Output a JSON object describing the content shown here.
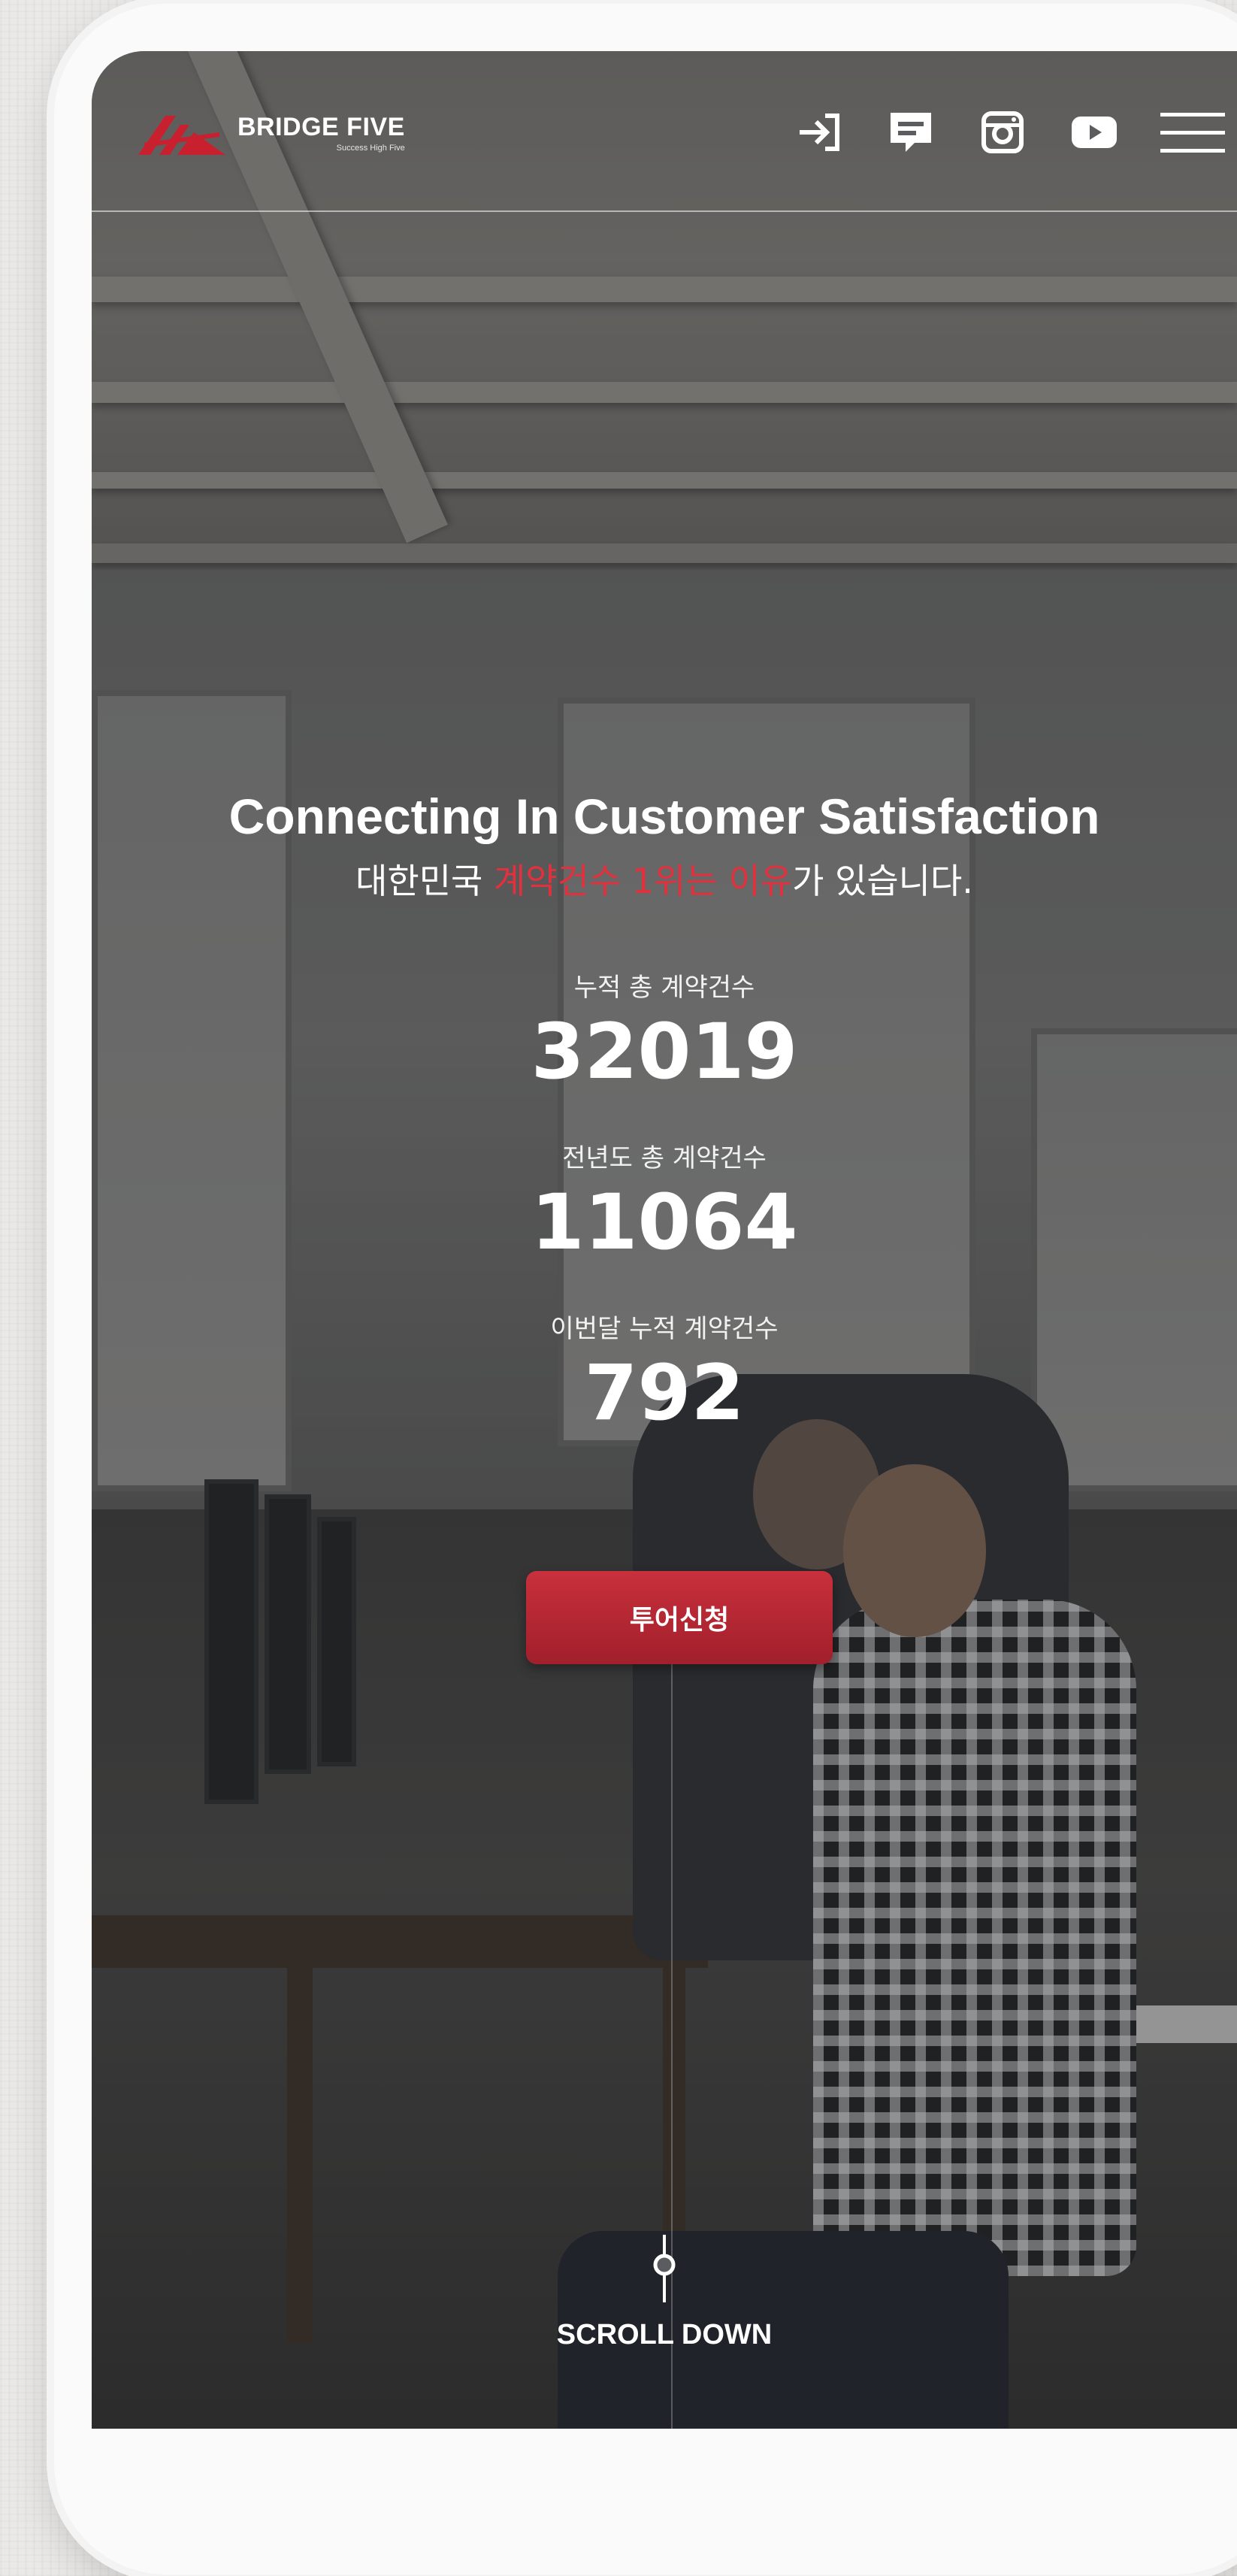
{
  "header": {
    "brand_name": "BRIDGE FIVE",
    "brand_slogan": "Success High Five",
    "icons": [
      "login-icon",
      "chat-icon",
      "instagram-icon",
      "youtube-icon",
      "menu-icon"
    ]
  },
  "hero": {
    "title": "Connecting In Customer Satisfaction",
    "subtitle_pre": "대한민국 ",
    "subtitle_highlight": "계약건수 1위는 이유",
    "subtitle_post": "가 있습니다.",
    "stats": [
      {
        "label": "누적 총 계약건수",
        "value": "32019"
      },
      {
        "label": "전년도 총 계약건수",
        "value": "11064"
      },
      {
        "label": "이번달 누적 계약건수",
        "value": "792"
      }
    ],
    "tour_button": "투어신청"
  },
  "scroll": {
    "label": "SCROLL DOWN"
  },
  "colors": {
    "accent": "#e0313f",
    "button": "#b82835"
  }
}
